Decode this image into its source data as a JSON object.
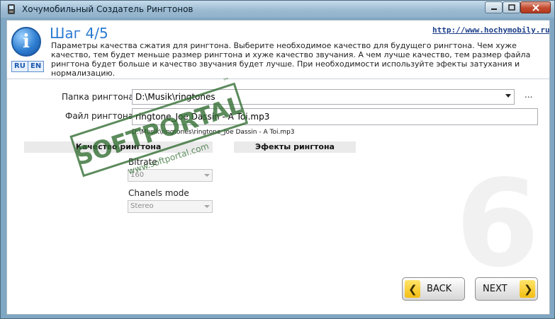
{
  "window": {
    "title": "Хочумобильный Создатель Рингтонов",
    "controls": {
      "minimize": "—",
      "maximize": "□",
      "close": "✕"
    }
  },
  "header": {
    "step_title": "Шаг 4/5",
    "site_link": "http://www.hochymobily.ru",
    "description": "Параметры качества сжатия для рингтона. Выберите необходимое качество для будущего рингтона. Чем хуже качество, тем будет меньше размер рингтона и хуже качество звучания. А чем лучше качество, тем размер файла рингтона будет больше и качество звучания будет лучше. При необходимости используйте эфекты затухания и нормализацию.",
    "info_icon_glyph": "i",
    "lang": {
      "ru": "RU",
      "en": "EN"
    }
  },
  "form": {
    "folder_label": "Папка рингтона",
    "folder_value": "D:\\Musik\\ringtones",
    "browse_label": "...",
    "file_label": "Файл рингтона",
    "file_value": "ringtone_Joe Dassin - A Toi.mp3",
    "full_path": "D:\\Musik\\ringtones\\ringtone_Joe Dassin - A Toi.mp3"
  },
  "sections": {
    "quality_title": "Качество рингтона",
    "effects_title": "Эфекты рингтона",
    "bitrate_label": "Bitrate",
    "bitrate_value": "160",
    "channels_label": "Chanels mode",
    "channels_value": "Stereo"
  },
  "buttons": {
    "back": "BACK",
    "next": "NEXT"
  },
  "watermark": {
    "line1": "SOFTPORTAL",
    "line2": "www.softportal.com",
    "tm": "™"
  },
  "colors": {
    "accent": "#2a7ad1",
    "button_yellow": "#f3be13",
    "watermark_green": "#2f6b2f"
  }
}
